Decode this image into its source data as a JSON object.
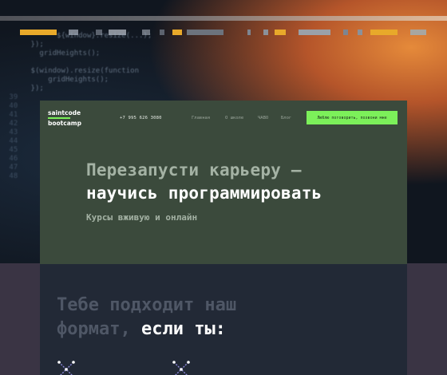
{
  "background": {
    "code_lines": [
      {
        "n": "",
        "text": "        ${window}.resize(...);"
      },
      {
        "n": "",
        "text": "  });"
      },
      {
        "n": "",
        "text": "    gridHeights();"
      },
      {
        "n": "",
        "text": ""
      },
      {
        "n": "",
        "text": "  $(window).resize(function"
      },
      {
        "n": "",
        "text": "      gridHeights();"
      },
      {
        "n": "",
        "text": "  });"
      },
      {
        "n": "39",
        "text": ""
      },
      {
        "n": "40",
        "text": ""
      },
      {
        "n": "41",
        "text": ""
      },
      {
        "n": "42",
        "text": ""
      },
      {
        "n": "43",
        "text": ""
      },
      {
        "n": "44",
        "text": ""
      },
      {
        "n": "45",
        "text": ""
      },
      {
        "n": "46",
        "text": ""
      },
      {
        "n": "47",
        "text": ""
      },
      {
        "n": "48",
        "text": ""
      }
    ]
  },
  "header": {
    "logo_line1": "saintcode",
    "logo_line2": "bootcamp",
    "phone": "+7 995 626 3080",
    "nav": [
      "Главная",
      "О школе",
      "ЧАВО",
      "Блог"
    ],
    "cta_label": "Люблю поговорить, позвони мне"
  },
  "hero": {
    "title_line1": "Перезапусти карьеру —",
    "title_line2": "научись программировать",
    "subtitle": "Курсы вживую и онлайн"
  },
  "section": {
    "title_dim_1": "Тебе подходит наш",
    "title_dim_2": "формат,",
    "title_lit": "если ты:"
  },
  "colors": {
    "accent": "#7cf05a",
    "hero_bg": "#3b4a3c",
    "section_bg": "#222936",
    "page_bg": "#3a3444"
  },
  "icons": [
    "network-x-icon",
    "network-x-icon"
  ]
}
